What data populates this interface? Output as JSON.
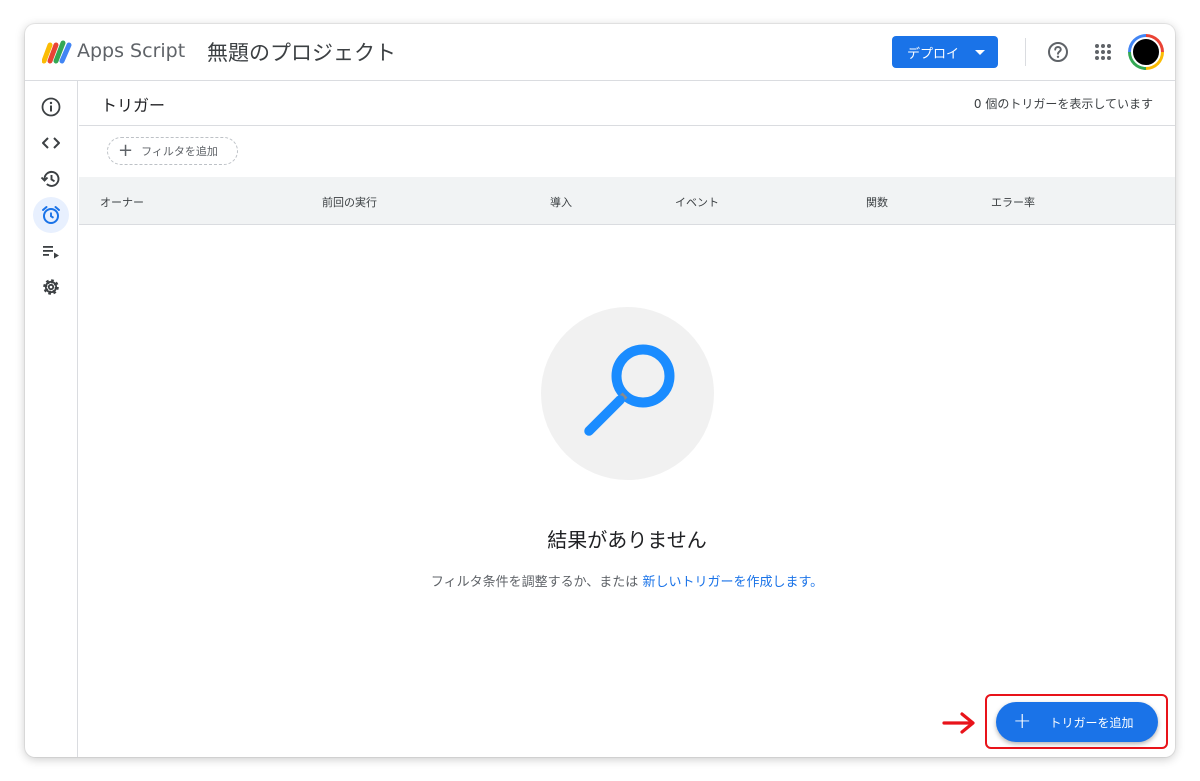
{
  "header": {
    "app_name": "Apps Script",
    "project_title": "無題のプロジェクト",
    "deploy_label": "デプロイ"
  },
  "sidebar": {
    "items": [
      {
        "icon": "info-icon"
      },
      {
        "icon": "code-icon"
      },
      {
        "icon": "history-icon"
      },
      {
        "icon": "alarm-clock-icon",
        "active": true
      },
      {
        "icon": "executions-icon"
      },
      {
        "icon": "gear-icon"
      }
    ]
  },
  "main": {
    "title": "トリガー",
    "count_text": "0 個のトリガーを表示しています",
    "filter_label": "フィルタを追加",
    "columns": [
      "オーナー",
      "前回の実行",
      "導入",
      "イベント",
      "関数",
      "エラー率"
    ],
    "empty_title": "結果がありません",
    "empty_desc_prefix": "フィルタ条件を調整するか、または ",
    "empty_desc_link": "新しいトリガーを作成します。",
    "add_trigger_label": "トリガーを追加"
  },
  "colors": {
    "accent": "#1a73e8",
    "highlight": "#e8131a"
  }
}
